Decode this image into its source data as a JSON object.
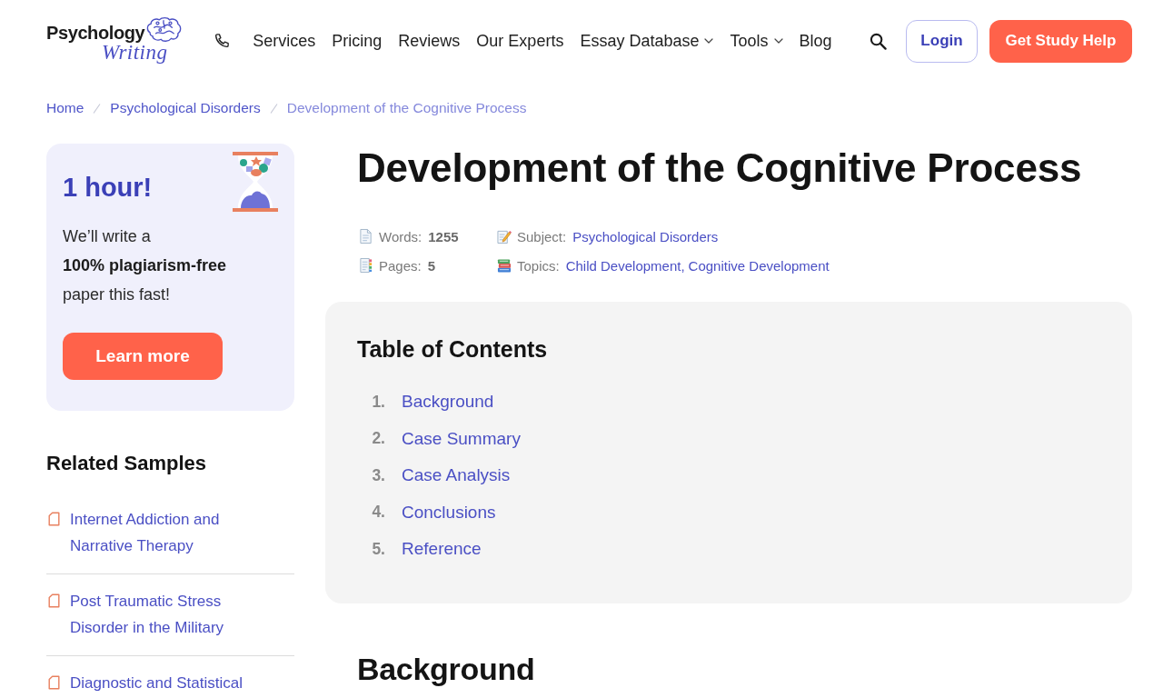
{
  "header": {
    "logo": {
      "wordmark": "Psychology",
      "script": "Writing"
    },
    "nav": [
      {
        "label": "Services",
        "dropdown": false
      },
      {
        "label": "Pricing",
        "dropdown": false
      },
      {
        "label": "Reviews",
        "dropdown": false
      },
      {
        "label": "Our Experts",
        "dropdown": false
      },
      {
        "label": "Essay Database",
        "dropdown": true
      },
      {
        "label": "Tools",
        "dropdown": true
      },
      {
        "label": "Blog",
        "dropdown": false
      }
    ],
    "login": "Login",
    "cta": "Get Study Help"
  },
  "breadcrumb": [
    {
      "label": "Home",
      "current": false
    },
    {
      "label": "Psychological Disorders",
      "current": false
    },
    {
      "label": "Development of the Cognitive Process",
      "current": true
    }
  ],
  "promo": {
    "title": "1 hour!",
    "text": "We’ll write a **100% plagiarism-free** paper this fast!",
    "button": "Learn more"
  },
  "related": {
    "title": "Related Samples",
    "items": [
      "Internet Addiction and Narrative Therapy",
      "Post Traumatic Stress Disorder in the Military",
      "Diagnostic and Statistical"
    ]
  },
  "article": {
    "title": "Development of the Cognitive Process",
    "meta": [
      {
        "kind": "number",
        "label": "Words:",
        "value": "1255"
      },
      {
        "kind": "links",
        "label": "Subject:",
        "links": [
          "Psychological Disorders"
        ]
      },
      {
        "kind": "number",
        "label": "Pages:",
        "value": "5"
      },
      {
        "kind": "links",
        "label": "Topics:",
        "links": [
          "Child Development",
          "Cognitive Development"
        ],
        "separator": ","
      }
    ],
    "toc": {
      "title": "Table of Contents",
      "items": [
        {
          "number": "1.",
          "label": "Background"
        },
        {
          "number": "2.",
          "label": "Case Summary"
        },
        {
          "number": "3.",
          "label": "Case Analysis"
        },
        {
          "number": "4.",
          "label": "Conclusions"
        },
        {
          "number": "5.",
          "label": "Reference"
        }
      ]
    },
    "sections": [
      {
        "heading": "Background"
      }
    ]
  }
}
